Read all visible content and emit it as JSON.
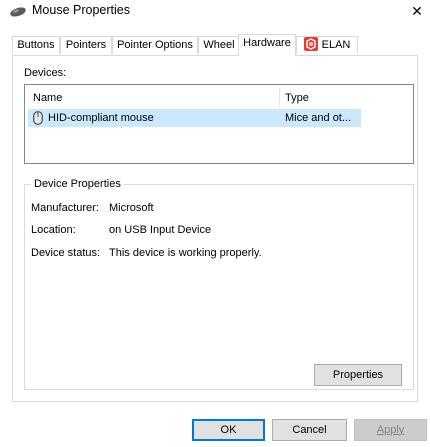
{
  "window": {
    "title": "Mouse Properties",
    "icon": "mouse-icon",
    "close_glyph": "✕"
  },
  "tabs": [
    {
      "label": "Buttons",
      "active": false
    },
    {
      "label": "Pointers",
      "active": false
    },
    {
      "label": "Pointer Options",
      "active": false
    },
    {
      "label": "Wheel",
      "active": false
    },
    {
      "label": "Hardware",
      "active": true
    },
    {
      "label": "ELAN",
      "active": false,
      "icon": "elan-icon"
    }
  ],
  "devices": {
    "label": "Devices:",
    "columns": [
      "Name",
      "Type"
    ],
    "rows": [
      {
        "name": "HID-compliant mouse",
        "type": "Mice and ot...",
        "selected": true,
        "icon": "mouse-device-icon"
      }
    ]
  },
  "device_properties": {
    "title": "Device Properties",
    "fields": [
      {
        "label": "Manufacturer:",
        "value": "Microsoft"
      },
      {
        "label": "Location:",
        "value": "on USB Input Device"
      },
      {
        "label": "Device status:",
        "value": "This device is working properly."
      }
    ],
    "properties_button": "Properties"
  },
  "buttons": {
    "ok": "OK",
    "cancel": "Cancel",
    "apply": "Apply"
  },
  "colors": {
    "selection": "#cce8ff",
    "default_button_border": "#0078d7",
    "elan_red": "#e03a3a"
  }
}
